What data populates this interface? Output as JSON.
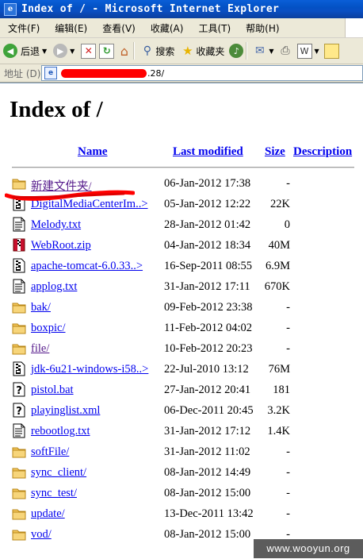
{
  "window": {
    "title": "Index of / - Microsoft Internet Explorer"
  },
  "menu": [
    {
      "label": "文件",
      "accel": "(F)"
    },
    {
      "label": "编辑",
      "accel": "(E)"
    },
    {
      "label": "查看",
      "accel": "(V)"
    },
    {
      "label": "收藏",
      "accel": "(A)"
    },
    {
      "label": "工具",
      "accel": "(T)"
    },
    {
      "label": "帮助",
      "accel": "(H)"
    }
  ],
  "toolbar": {
    "back_label": "后退",
    "search_label": "搜索",
    "favorites_label": "收藏夹"
  },
  "address": {
    "label": "地址 (D)",
    "url_suffix": ".28/"
  },
  "page": {
    "title": "Index of /",
    "columns": {
      "name": "Name",
      "modified": "Last modified",
      "size": "Size",
      "description": "Description"
    },
    "files": [
      {
        "name": "新建文件夹/",
        "date": "06-Jan-2012 17:38",
        "size": "-",
        "icon": "folder-icon",
        "visited": true
      },
      {
        "name": "DigitalMediaCenterIm..>",
        "date": "05-Jan-2012 12:22",
        "size": "22K",
        "icon": "compressed-file-icon",
        "visited": false
      },
      {
        "name": "Melody.txt",
        "date": "28-Jan-2012 01:42",
        "size": "0",
        "icon": "text-file-icon",
        "visited": false
      },
      {
        "name": "WebRoot.zip",
        "date": "04-Jan-2012 18:34",
        "size": "40M",
        "icon": "zip-archive-icon",
        "visited": false
      },
      {
        "name": "apache-tomcat-6.0.33..>",
        "date": "16-Sep-2011 08:55",
        "size": "6.9M",
        "icon": "compressed-file-icon",
        "visited": false
      },
      {
        "name": "applog.txt",
        "date": "31-Jan-2012 17:11",
        "size": "670K",
        "icon": "text-file-icon",
        "visited": false
      },
      {
        "name": "bak/",
        "date": "09-Feb-2012 23:38",
        "size": "-",
        "icon": "folder-icon",
        "visited": false
      },
      {
        "name": "boxpic/",
        "date": "11-Feb-2012 04:02",
        "size": "-",
        "icon": "folder-icon",
        "visited": false
      },
      {
        "name": "file/",
        "date": "10-Feb-2012 20:23",
        "size": "-",
        "icon": "folder-icon",
        "visited": true
      },
      {
        "name": "jdk-6u21-windows-i58..>",
        "date": "22-Jul-2010 13:12",
        "size": "76M",
        "icon": "compressed-file-icon",
        "visited": false
      },
      {
        "name": "pistol.bat",
        "date": "27-Jan-2012 20:41",
        "size": "181",
        "icon": "unknown-file-icon",
        "visited": false
      },
      {
        "name": "playinglist.xml",
        "date": "06-Dec-2011 20:45",
        "size": "3.2K",
        "icon": "unknown-file-icon",
        "visited": false
      },
      {
        "name": "rebootlog.txt",
        "date": "31-Jan-2012 17:12",
        "size": "1.4K",
        "icon": "text-file-icon",
        "visited": false
      },
      {
        "name": "softFile/",
        "date": "31-Jan-2012 11:02",
        "size": "-",
        "icon": "folder-icon",
        "visited": false
      },
      {
        "name": "sync_client/",
        "date": "08-Jan-2012 14:49",
        "size": "-",
        "icon": "folder-icon",
        "visited": false
      },
      {
        "name": "sync_test/",
        "date": "08-Jan-2012 15:00",
        "size": "-",
        "icon": "folder-icon",
        "visited": false
      },
      {
        "name": "update/",
        "date": "13-Dec-2011 13:42",
        "size": "-",
        "icon": "folder-icon",
        "visited": false
      },
      {
        "name": "vod/",
        "date": "08-Jan-2012 15:00",
        "size": "-",
        "icon": "folder-icon",
        "visited": false
      }
    ]
  },
  "watermark": "www.wooyun.org",
  "colors": {
    "link": "#0000ee",
    "visited": "#551a8b",
    "titlebar": "#0a5fd8",
    "chrome": "#ece9d8",
    "redaction": "#ff0000"
  }
}
